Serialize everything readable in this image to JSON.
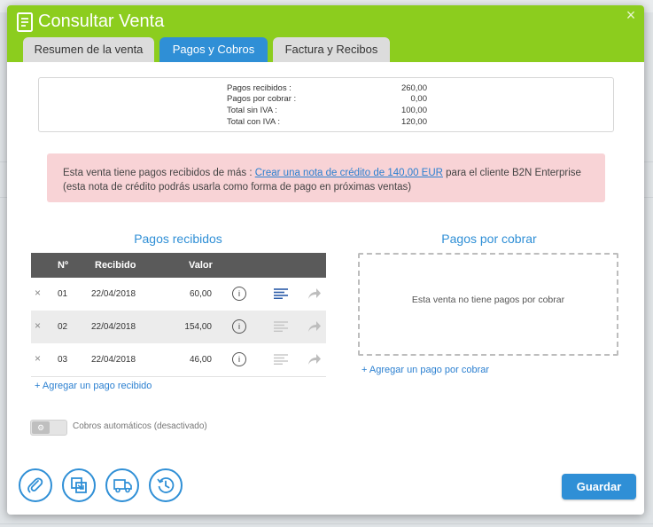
{
  "window": {
    "title": "Consultar Venta",
    "close_glyph": "×",
    "icons": {
      "title": "document-icon",
      "close": "close-icon"
    },
    "accent_color": "#8ccd1e",
    "primary_color": "#2f8fd6"
  },
  "tabs": [
    {
      "label": "Resumen de la venta",
      "active": false
    },
    {
      "label": "Pagos y Cobros",
      "active": true
    },
    {
      "label": "Factura y Recibos",
      "active": false
    }
  ],
  "summary": {
    "rows": [
      {
        "label": "Pagos recibidos :",
        "value": "260,00"
      },
      {
        "label": "Pagos por cobrar :",
        "value": "0,00"
      },
      {
        "label": "Total sin IVA :",
        "value": "100,00"
      },
      {
        "label": "Total con IVA :",
        "value": "120,00"
      }
    ]
  },
  "alert": {
    "text_before": "Esta venta tiene pagos recibidos de más : ",
    "link": "Crear una nota de crédito de 140,00 EUR",
    "text_after": " para el cliente B2N Enterprise",
    "line2": "(esta nota de crédito podrás usarla como forma de pago en próximas ventas)",
    "background": "#f8d3d6"
  },
  "received": {
    "title": "Pagos recibidos",
    "headers": {
      "num": "Nº",
      "date": "Recibido",
      "value": "Valor"
    },
    "rows": [
      {
        "delete": "×",
        "num": "01",
        "date": "22/04/2018",
        "value": "60,00",
        "info": "i"
      },
      {
        "delete": "×",
        "num": "02",
        "date": "22/04/2018",
        "value": "154,00",
        "info": "i"
      },
      {
        "delete": "×",
        "num": "03",
        "date": "22/04/2018",
        "value": "46,00",
        "info": "i"
      }
    ],
    "add_link": "+ Agregar un pago recibido"
  },
  "pending": {
    "title": "Pagos por cobrar",
    "empty_text": "Esta venta no tiene pagos por cobrar",
    "add_link": "+ Agregar un pago por cobrar"
  },
  "auto_collect": {
    "label": "Cobros automáticos (desactivado)",
    "enabled": false,
    "knob_glyph": "⚙"
  },
  "footer": {
    "icon_buttons": [
      "paperclip-icon",
      "duplicate-icon",
      "truck-icon",
      "history-icon"
    ],
    "save_label": "Guardar"
  }
}
